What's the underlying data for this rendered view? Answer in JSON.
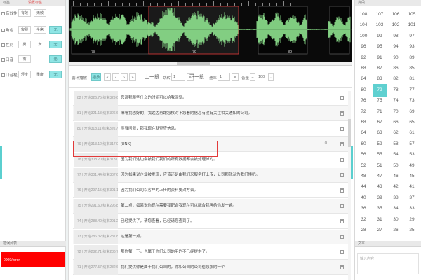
{
  "left_panel": {
    "header": "标签",
    "header_accent": "设置标签",
    "rows": [
      {
        "label": "有效性",
        "checkbox": true,
        "buttons": [
          {
            "text": "有效",
            "on": false
          },
          {
            "text": "无效",
            "on": false
          }
        ]
      },
      {
        "label": "角色",
        "checkbox": true,
        "buttons": [
          {
            "text": "客服",
            "on": false
          },
          {
            "text": "坐席",
            "on": false
          },
          {
            "text": "无",
            "on": true
          }
        ]
      },
      {
        "label": "性别",
        "checkbox": true,
        "buttons": [
          {
            "text": "男",
            "on": false
          },
          {
            "text": "女",
            "on": false
          },
          {
            "text": "无",
            "on": true
          }
        ]
      },
      {
        "label": "口音",
        "checkbox": true,
        "buttons": [
          {
            "text": "有",
            "on": false
          },
          {
            "text": "无",
            "on": true
          }
        ]
      },
      {
        "label": "口音程度",
        "checkbox": true,
        "buttons": [
          {
            "text": "轻度",
            "on": false
          },
          {
            "text": "重度",
            "on": false
          },
          {
            "text": "无",
            "on": true
          }
        ]
      }
    ],
    "bottom_header": "错误列表",
    "error_text": "0009/error"
  },
  "waveform": {
    "ruler": [
      "78",
      "79",
      "80"
    ]
  },
  "toolbar": {
    "label_loop": "循环播放",
    "play": "播放",
    "prev_big": "上一段",
    "jump_label": "跳转",
    "jump_value": "1",
    "next_big": "下一段",
    "speed_label": "速率",
    "speed_value": "1",
    "volume_label": "音量",
    "volume_value": "100"
  },
  "segments": [
    {
      "time": "82 | 开始326.75 结束329.66",
      "text": "您说我那些什么的时间可以给我回复。",
      "marker": ""
    },
    {
      "time": "81 | 开始321.13 结束326.67",
      "text": "嗯嗯我也好的，我这边再跟您核对下您看的信息有没有关注相关通知的公司。",
      "marker": ""
    },
    {
      "time": "80 | 开始318.11 结束320.72",
      "text": "没有问题，那我现在就查查信息。",
      "marker": ""
    },
    {
      "time": "79 | 开始313.12 结束317.07",
      "text": "[UNK]",
      "marker": "0"
    },
    {
      "time": "78 | 开始308.20 结束313.04",
      "text": "因为我们这边会被我们我们的所有数据都会被处理掉的。",
      "marker": ""
    },
    {
      "time": "77 | 开始301.44 结束307.66",
      "text": "因为如果说企业被发现，应该还是由我们来服务好上传，公司那就认为我们懂吧。",
      "marker": ""
    },
    {
      "time": "76 | 开始297.15 结束301.13",
      "text": "因为我们公司以客户的上传的资料要对方去。",
      "marker": ""
    },
    {
      "time": "75 | 开始291.60 结束296.83",
      "text": "第二点，如果说你现在需要我配合我现在可以配合我再给你发一遍。",
      "marker": ""
    },
    {
      "time": "74 | 开始288.40 结束291.29",
      "text": "已经提供了，请您查看，已经请您查到了。",
      "marker": ""
    },
    {
      "time": "73 | 开始286.32 结束287.89",
      "text": "这是第一点。",
      "marker": ""
    },
    {
      "time": "72 | 开始282.71 结束286.70",
      "text": "那你第一下，也属于你们公司的用的不已经提供了。",
      "marker": ""
    },
    {
      "time": "71 | 开始277.57 结束282.67",
      "text": "我们提供你是属于我们公司的，你和公司的公司给您那的一个",
      "marker": ""
    }
  ],
  "right_panel": {
    "header": "片段",
    "numbers": [
      108,
      107,
      106,
      105,
      104,
      103,
      102,
      101,
      100,
      99,
      98,
      97,
      96,
      95,
      94,
      93,
      92,
      91,
      90,
      89,
      88,
      87,
      86,
      85,
      84,
      83,
      82,
      81,
      80,
      79,
      78,
      77,
      76,
      75,
      74,
      73,
      72,
      71,
      70,
      69,
      68,
      67,
      66,
      65,
      64,
      63,
      62,
      61,
      60,
      59,
      58,
      57,
      56,
      55,
      54,
      53,
      52,
      51,
      50,
      49,
      48,
      47,
      46,
      45,
      44,
      43,
      42,
      41,
      40,
      39,
      38,
      37,
      36,
      35,
      34,
      33,
      32,
      31,
      30,
      29,
      28,
      27,
      26,
      25
    ],
    "selected": 79,
    "bottom_header": "文本",
    "note_placeholder": "输入内容"
  },
  "colors": {
    "accent": "#8fe5e5",
    "wave": "#8ee38e",
    "wave_bg": "#0a0a0a",
    "highlight": "#e23a3a",
    "error": "#ff0000"
  }
}
